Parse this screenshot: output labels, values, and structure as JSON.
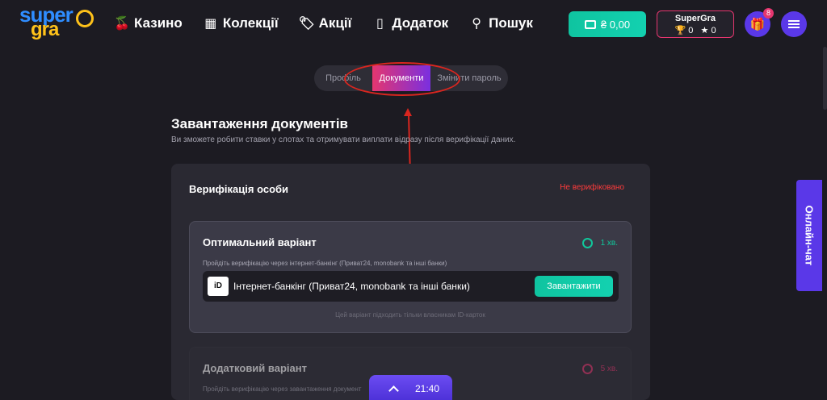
{
  "header": {
    "logo_top": "super",
    "logo_bottom": "gra",
    "nav": [
      {
        "label": "Казино",
        "icon": "cherries-icon"
      },
      {
        "label": "Колекції",
        "icon": "grid-icon"
      },
      {
        "label": "Акції",
        "icon": "tag-icon"
      },
      {
        "label": "Додаток",
        "icon": "phone-icon"
      },
      {
        "label": "Пошук",
        "icon": "search-icon"
      }
    ],
    "wallet_label": "₴ 0,00",
    "profile_name": "SuperGra",
    "trophies": "0",
    "stars": "0",
    "gift_badge": "8"
  },
  "tabs": [
    {
      "label": "Профіль",
      "active": false
    },
    {
      "label": "Документи",
      "active": true
    },
    {
      "label": "Змінити пароль",
      "active": false
    }
  ],
  "page": {
    "title": "Завантаження документів",
    "subtitle": "Ви зможете робити ставки у слотах та отримувати виплати відразу після верифікації даних."
  },
  "verification": {
    "title": "Верифікація особи",
    "status": "Не верифіковано",
    "status_color": "#ff3b3b"
  },
  "options": [
    {
      "title": "Оптимальний варіант",
      "time": "1 хв.",
      "hint": "Пройдіть верифікацію через інтернет-банкінг (Приват24, monobank та інші банки)",
      "method_label": "Інтернет-банкінг (Приват24, monobank та інші банки)",
      "logo_text": "iD",
      "button": "Завантажити",
      "footnote": "Цей варіант підходить тільки власникам ID-карток"
    },
    {
      "title": "Додатковий варіант",
      "time": "5 хв.",
      "hint": "Пройдіть верифікацію через завантаження документ"
    }
  ],
  "chat_label": "Онлайн-чат",
  "clock": "21:40",
  "colors": {
    "accent_teal": "#10c79b",
    "accent_purple": "#5a38e8",
    "accent_pink": "#e5366f",
    "annotation_red": "#d9261f"
  }
}
